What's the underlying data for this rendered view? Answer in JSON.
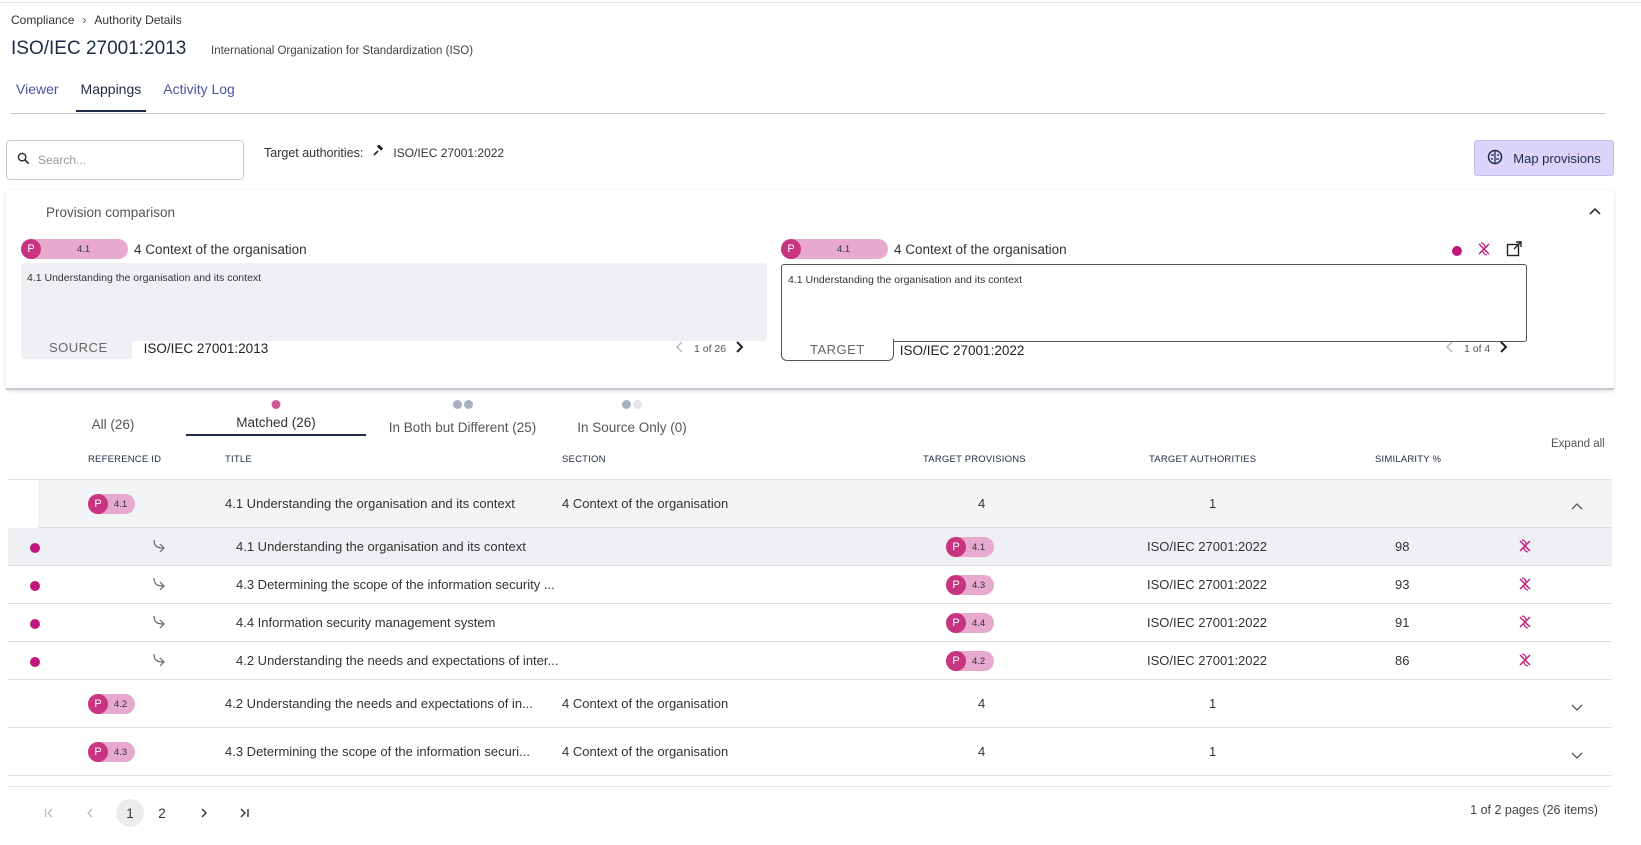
{
  "breadcrumb": {
    "root": "Compliance",
    "current": "Authority Details"
  },
  "header": {
    "title": "ISO/IEC 27001:2013",
    "subtitle": "International Organization for Standardization (ISO)"
  },
  "tabs": [
    {
      "label": "Viewer"
    },
    {
      "label": "Mappings"
    },
    {
      "label": "Activity Log"
    }
  ],
  "toolbar": {
    "search_placeholder": "Search...",
    "target_authorities_label": "Target authorities:",
    "target_authority": "ISO/IEC 27001:2022",
    "map_button": "Map provisions"
  },
  "comparison": {
    "heading": "Provision comparison",
    "source": {
      "badge_letter": "P",
      "badge_number": "4.1",
      "title": "4 Context of the organisation",
      "text": "4.1 Understanding the organisation and its context",
      "tag": "SOURCE",
      "authority": "ISO/IEC 27001:2013",
      "pager": "1 of 26"
    },
    "target": {
      "badge_letter": "P",
      "badge_number": "4.1",
      "title": "4 Context of the organisation",
      "text": "4.1 Understanding the organisation and its context",
      "tag": "TARGET",
      "authority": "ISO/IEC 27001:2022",
      "pager": "1 of 4"
    }
  },
  "status_tabs": [
    {
      "label": "All (26)"
    },
    {
      "label": "Matched (26)"
    },
    {
      "label": "In Both but Different (25)"
    },
    {
      "label": "In Source Only (0)"
    }
  ],
  "expand_all": "Expand all",
  "table": {
    "columns": {
      "reference_id": "REFERENCE ID",
      "title": "TITLE",
      "section": "SECTION",
      "target_provisions": "TARGET PROVISIONS",
      "target_authorities": "TARGET AUTHORITIES",
      "similarity": "SIMILARITY %"
    },
    "groups": [
      {
        "badge": "4.1",
        "title": "4.1 Understanding the organisation and its context",
        "section": "4 Context of the organisation",
        "target_provisions": "4",
        "target_authorities": "1"
      },
      {
        "badge": "4.2",
        "title": "4.2 Understanding the needs and expectations of in...",
        "section": "4 Context of the organisation",
        "target_provisions": "4",
        "target_authorities": "1"
      },
      {
        "badge": "4.3",
        "title": "4.3 Determining the scope of the information securi...",
        "section": "4 Context of the organisation",
        "target_provisions": "4",
        "target_authorities": "1"
      }
    ],
    "sub_rows": [
      {
        "title": "4.1 Understanding the organisation and its context",
        "badge": "4.1",
        "authority": "ISO/IEC 27001:2022",
        "similarity": "98"
      },
      {
        "title": "4.3 Determining the scope of the information security ...",
        "badge": "4.3",
        "authority": "ISO/IEC 27001:2022",
        "similarity": "93"
      },
      {
        "title": "4.4 Information security management system",
        "badge": "4.4",
        "authority": "ISO/IEC 27001:2022",
        "similarity": "91"
      },
      {
        "title": "4.2 Understanding the needs and expectations of inter...",
        "badge": "4.2",
        "authority": "ISO/IEC 27001:2022",
        "similarity": "86"
      }
    ]
  },
  "pagination": {
    "pages": [
      "1",
      "2"
    ],
    "info": "1 of 2 pages (26 items)"
  },
  "colors": {
    "accent": "#c0157c",
    "badge_bg": "#e7a9cd",
    "badge_p": "#c7347f",
    "map_button_bg": "#dcd4fb",
    "tab_active": "#1f2a44",
    "link": "#4a55a2"
  },
  "icons": [
    "search-icon",
    "gavel-icon",
    "brain-icon",
    "chevron-up-icon",
    "unlink-icon",
    "external-link-icon",
    "chevron-left-icon",
    "chevron-right-icon",
    "mapping-arrow-icon",
    "chevron-down-icon",
    "first-page-icon",
    "last-page-icon"
  ]
}
